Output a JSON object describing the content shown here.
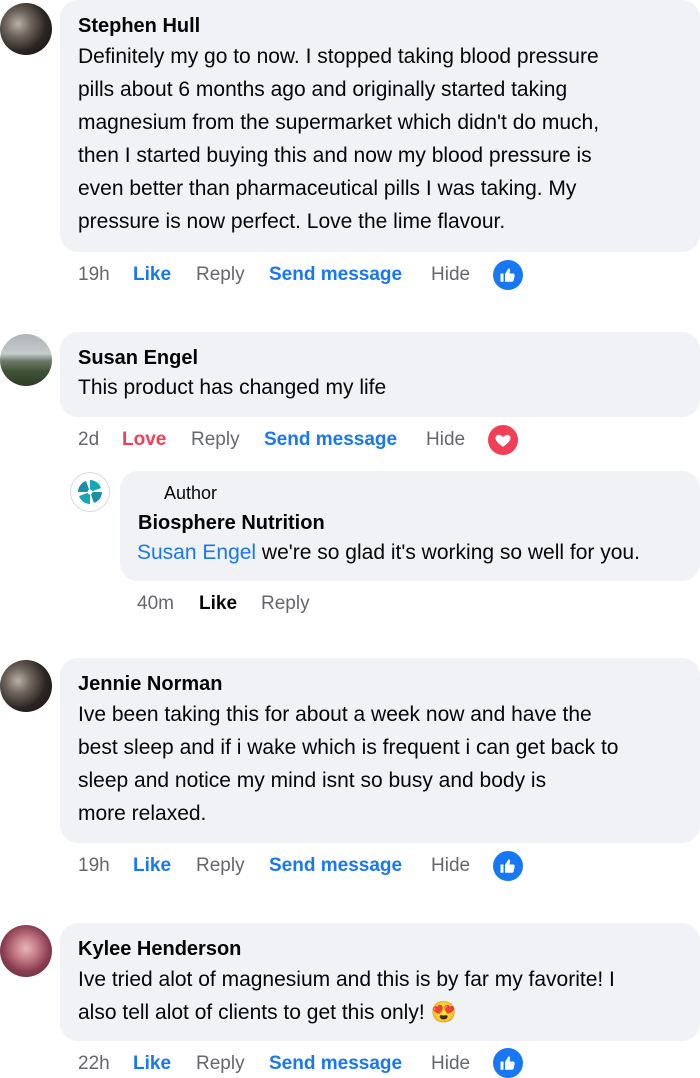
{
  "comments": [
    {
      "name": "Stephen Hull",
      "lines": [
        "Definitely my go to now. I stopped taking blood pressure",
        "pills about 6 months ago and originally started taking",
        "magnesium from the supermarket which didn't do much,",
        "then I started buying this and now my blood pressure is",
        "even better than pharmaceutical pills I was taking. My",
        "pressure is now perfect. Love the lime flavour."
      ],
      "time": "19h",
      "reaction_label": "Like",
      "reply": "Reply",
      "send_message": "Send message",
      "hide": "Hide",
      "reaction_icon": "like-icon"
    },
    {
      "name": "Susan Engel",
      "lines": [
        "This product has changed my life"
      ],
      "time": "2d",
      "reaction_label": "Love",
      "reply": "Reply",
      "send_message": "Send message",
      "hide": "Hide",
      "reaction_icon": "love-icon",
      "reply_thread": {
        "author_label": "Author",
        "name": "Biosphere Nutrition",
        "mention": "Susan Engel",
        "text": " we're so glad it's working so well for you.",
        "time": "40m",
        "like": "Like",
        "reply": "Reply"
      }
    },
    {
      "name": "Jennie Norman",
      "lines": [
        "Ive been taking this for about a week now and have the",
        "best sleep and if i wake which is frequent i can get back to",
        "sleep and notice my mind isnt so busy and body is",
        "more relaxed."
      ],
      "time": "19h",
      "reaction_label": "Like",
      "reply": "Reply",
      "send_message": "Send message",
      "hide": "Hide",
      "reaction_icon": "like-icon"
    },
    {
      "name": "Kylee Henderson",
      "lines": [
        "Ive tried alot of magnesium and this is by far my favorite! I",
        "also tell alot of clients to get this only!"
      ],
      "emoji": "😍",
      "time": "22h",
      "reaction_label": "Like",
      "reply": "Reply",
      "send_message": "Send message",
      "hide": "Hide",
      "reaction_icon": "like-icon"
    }
  ],
  "colors": {
    "accent": "#1877f2",
    "love": "#f33e58",
    "bubble": "#f0f2f5",
    "meta_text": "#65676b"
  }
}
